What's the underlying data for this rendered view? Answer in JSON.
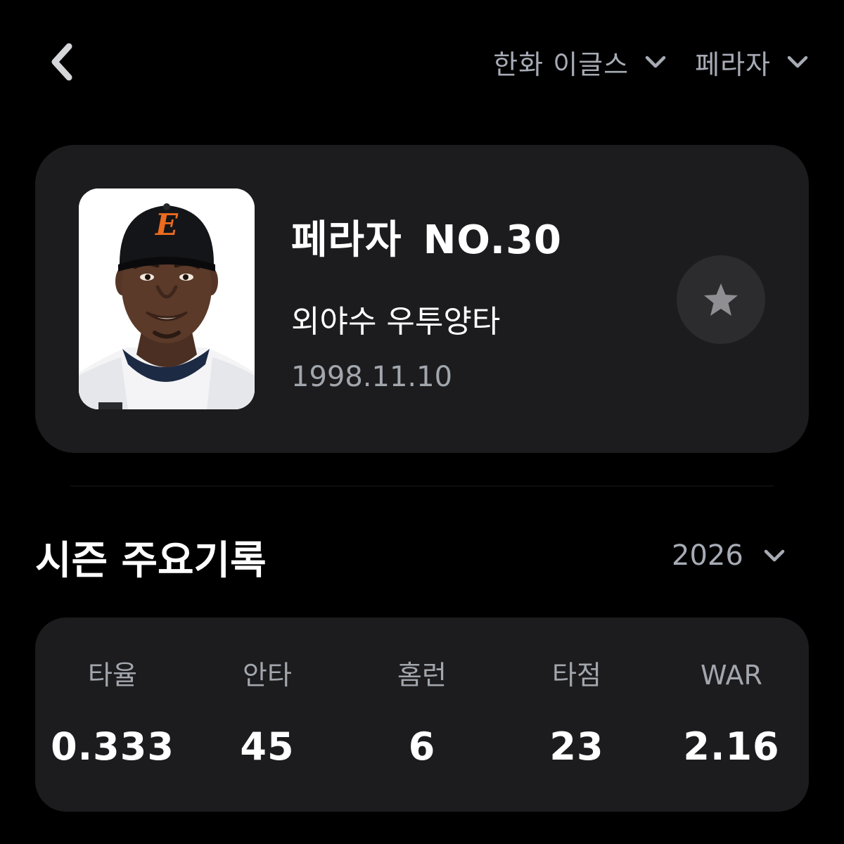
{
  "header": {
    "team_select": "한화 이글스",
    "player_select": "페라자"
  },
  "player": {
    "name": "페라자",
    "number": "NO.30",
    "position": "외야수 우투양타",
    "birth": "1998.11.10",
    "cap_logo": "E"
  },
  "season": {
    "title": "시즌 주요기록",
    "year": "2026"
  },
  "stats": [
    {
      "label": "타율",
      "value": "0.333"
    },
    {
      "label": "안타",
      "value": "45"
    },
    {
      "label": "홈런",
      "value": "6"
    },
    {
      "label": "타점",
      "value": "23"
    },
    {
      "label": "WAR",
      "value": "2.16"
    }
  ],
  "icons": {
    "back": "chevron-left-icon",
    "dropdown": "chevron-down-icon",
    "favorite": "star-icon"
  },
  "colors": {
    "background": "#000000",
    "card": "#1c1c1e",
    "muted_text": "#a6abb5",
    "star": "#8e8e93"
  }
}
